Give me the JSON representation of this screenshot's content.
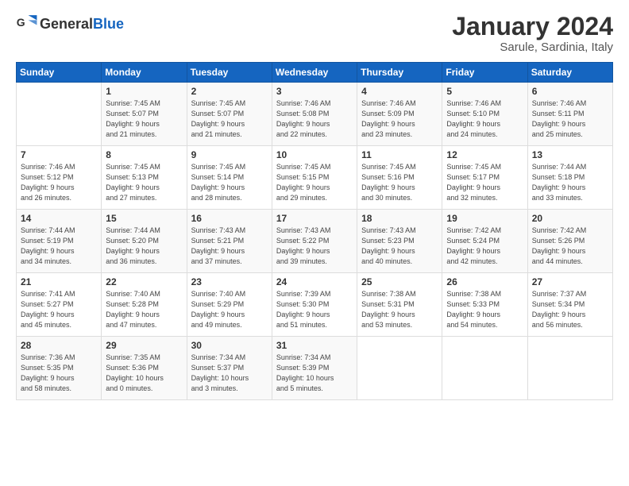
{
  "header": {
    "logo_general": "General",
    "logo_blue": "Blue",
    "month": "January 2024",
    "location": "Sarule, Sardinia, Italy"
  },
  "columns": [
    "Sunday",
    "Monday",
    "Tuesday",
    "Wednesday",
    "Thursday",
    "Friday",
    "Saturday"
  ],
  "weeks": [
    [
      {
        "day": "",
        "info": ""
      },
      {
        "day": "1",
        "info": "Sunrise: 7:45 AM\nSunset: 5:07 PM\nDaylight: 9 hours\nand 21 minutes."
      },
      {
        "day": "2",
        "info": "Sunrise: 7:45 AM\nSunset: 5:07 PM\nDaylight: 9 hours\nand 21 minutes."
      },
      {
        "day": "3",
        "info": "Sunrise: 7:46 AM\nSunset: 5:08 PM\nDaylight: 9 hours\nand 22 minutes."
      },
      {
        "day": "4",
        "info": "Sunrise: 7:46 AM\nSunset: 5:09 PM\nDaylight: 9 hours\nand 23 minutes."
      },
      {
        "day": "5",
        "info": "Sunrise: 7:46 AM\nSunset: 5:10 PM\nDaylight: 9 hours\nand 24 minutes."
      },
      {
        "day": "6",
        "info": "Sunrise: 7:46 AM\nSunset: 5:11 PM\nDaylight: 9 hours\nand 25 minutes."
      }
    ],
    [
      {
        "day": "7",
        "info": "Sunrise: 7:46 AM\nSunset: 5:12 PM\nDaylight: 9 hours\nand 26 minutes."
      },
      {
        "day": "8",
        "info": "Sunrise: 7:45 AM\nSunset: 5:13 PM\nDaylight: 9 hours\nand 27 minutes."
      },
      {
        "day": "9",
        "info": "Sunrise: 7:45 AM\nSunset: 5:14 PM\nDaylight: 9 hours\nand 28 minutes."
      },
      {
        "day": "10",
        "info": "Sunrise: 7:45 AM\nSunset: 5:15 PM\nDaylight: 9 hours\nand 29 minutes."
      },
      {
        "day": "11",
        "info": "Sunrise: 7:45 AM\nSunset: 5:16 PM\nDaylight: 9 hours\nand 30 minutes."
      },
      {
        "day": "12",
        "info": "Sunrise: 7:45 AM\nSunset: 5:17 PM\nDaylight: 9 hours\nand 32 minutes."
      },
      {
        "day": "13",
        "info": "Sunrise: 7:44 AM\nSunset: 5:18 PM\nDaylight: 9 hours\nand 33 minutes."
      }
    ],
    [
      {
        "day": "14",
        "info": "Sunrise: 7:44 AM\nSunset: 5:19 PM\nDaylight: 9 hours\nand 34 minutes."
      },
      {
        "day": "15",
        "info": "Sunrise: 7:44 AM\nSunset: 5:20 PM\nDaylight: 9 hours\nand 36 minutes."
      },
      {
        "day": "16",
        "info": "Sunrise: 7:43 AM\nSunset: 5:21 PM\nDaylight: 9 hours\nand 37 minutes."
      },
      {
        "day": "17",
        "info": "Sunrise: 7:43 AM\nSunset: 5:22 PM\nDaylight: 9 hours\nand 39 minutes."
      },
      {
        "day": "18",
        "info": "Sunrise: 7:43 AM\nSunset: 5:23 PM\nDaylight: 9 hours\nand 40 minutes."
      },
      {
        "day": "19",
        "info": "Sunrise: 7:42 AM\nSunset: 5:24 PM\nDaylight: 9 hours\nand 42 minutes."
      },
      {
        "day": "20",
        "info": "Sunrise: 7:42 AM\nSunset: 5:26 PM\nDaylight: 9 hours\nand 44 minutes."
      }
    ],
    [
      {
        "day": "21",
        "info": "Sunrise: 7:41 AM\nSunset: 5:27 PM\nDaylight: 9 hours\nand 45 minutes."
      },
      {
        "day": "22",
        "info": "Sunrise: 7:40 AM\nSunset: 5:28 PM\nDaylight: 9 hours\nand 47 minutes."
      },
      {
        "day": "23",
        "info": "Sunrise: 7:40 AM\nSunset: 5:29 PM\nDaylight: 9 hours\nand 49 minutes."
      },
      {
        "day": "24",
        "info": "Sunrise: 7:39 AM\nSunset: 5:30 PM\nDaylight: 9 hours\nand 51 minutes."
      },
      {
        "day": "25",
        "info": "Sunrise: 7:38 AM\nSunset: 5:31 PM\nDaylight: 9 hours\nand 53 minutes."
      },
      {
        "day": "26",
        "info": "Sunrise: 7:38 AM\nSunset: 5:33 PM\nDaylight: 9 hours\nand 54 minutes."
      },
      {
        "day": "27",
        "info": "Sunrise: 7:37 AM\nSunset: 5:34 PM\nDaylight: 9 hours\nand 56 minutes."
      }
    ],
    [
      {
        "day": "28",
        "info": "Sunrise: 7:36 AM\nSunset: 5:35 PM\nDaylight: 9 hours\nand 58 minutes."
      },
      {
        "day": "29",
        "info": "Sunrise: 7:35 AM\nSunset: 5:36 PM\nDaylight: 10 hours\nand 0 minutes."
      },
      {
        "day": "30",
        "info": "Sunrise: 7:34 AM\nSunset: 5:37 PM\nDaylight: 10 hours\nand 3 minutes."
      },
      {
        "day": "31",
        "info": "Sunrise: 7:34 AM\nSunset: 5:39 PM\nDaylight: 10 hours\nand 5 minutes."
      },
      {
        "day": "",
        "info": ""
      },
      {
        "day": "",
        "info": ""
      },
      {
        "day": "",
        "info": ""
      }
    ]
  ]
}
